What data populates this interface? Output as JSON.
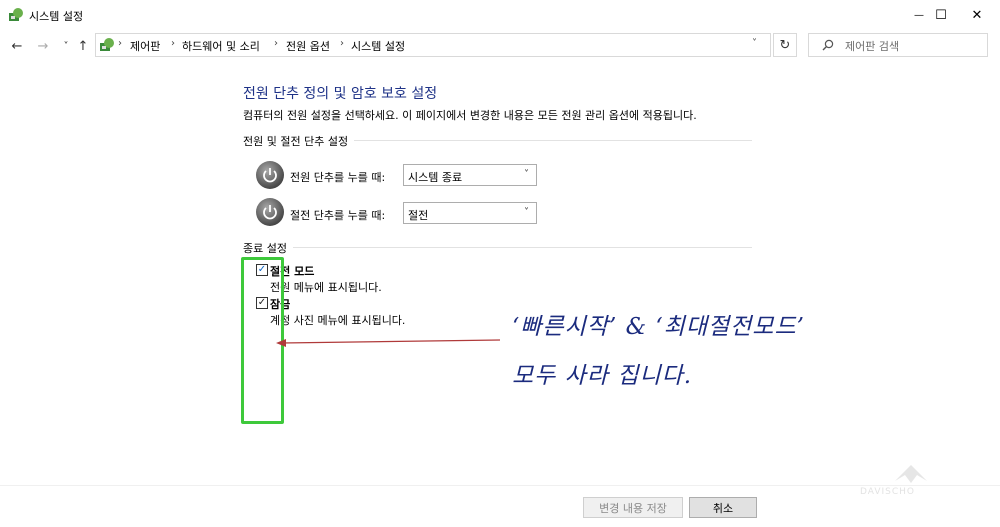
{
  "window": {
    "title": "시스템 설정",
    "minimize_glyph": "—",
    "maximize_glyph": "☐",
    "close_glyph": "✕"
  },
  "nav": {
    "back_glyph": "←",
    "forward_glyph": "→",
    "recent_glyph": "˅",
    "up_glyph": "↑",
    "refresh_glyph": "↻",
    "dropdown_glyph": "˅"
  },
  "breadcrumb": [
    "제어판",
    "하드웨어 및 소리",
    "전원 옵션",
    "시스템 설정"
  ],
  "breadcrumb_sep": "›",
  "search": {
    "placeholder": "제어판 검색"
  },
  "main": {
    "title": "전원 단추 정의 및 암호 보호 설정",
    "description": "컴퓨터의 전원 설정을 선택하세요. 이 페이지에서 변경한 내용은 모든 전원 관리 옵션에 적용됩니다.",
    "power_section_label": "전원 및 절전 단추 설정",
    "power_rows": [
      {
        "label": "전원 단추를 누를 때:",
        "value": "시스템 종료"
      },
      {
        "label": "절전 단추를 누를 때:",
        "value": "절전"
      }
    ],
    "shutdown_section_label": "종료 설정",
    "shutdown_options": [
      {
        "label": "절전 모드",
        "description": "전원 메뉴에 표시됩니다.",
        "checked": true
      },
      {
        "label": "잠금",
        "description": "계정 사진 메뉴에 표시됩니다.",
        "checked": true
      }
    ]
  },
  "annotation": {
    "line1": "‘빠른시작’ & ‘최대절전모드’",
    "line2": "모두 사라 집니다.",
    "color": "#1b2b7e",
    "highlight_color": "#3ec93b",
    "arrow_color": "#b03a3a"
  },
  "watermark": "DAVISCHO",
  "footer": {
    "save_label": "변경 내용 저장",
    "cancel_label": "취소"
  },
  "icons": [
    "control-panel-icon",
    "search-icon",
    "power-button-icon",
    "checkmark-icon"
  ]
}
